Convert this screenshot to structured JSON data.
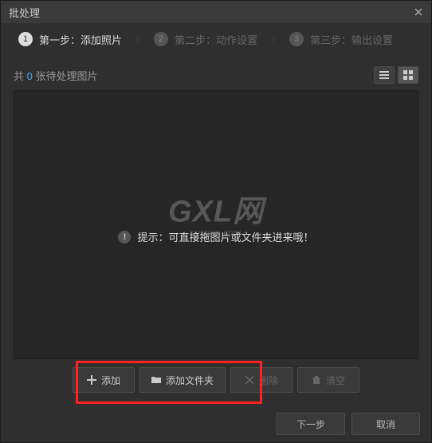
{
  "window": {
    "title": "批处理"
  },
  "steps": {
    "s1": {
      "num": "1",
      "label": "第一步：添加照片"
    },
    "s2": {
      "num": "2",
      "label": "第二步：动作设置"
    },
    "s3": {
      "num": "3",
      "label": "第三步：输出设置"
    }
  },
  "header": {
    "prefix": "共 ",
    "count": "0",
    "suffix": " 张待处理图片"
  },
  "hint": {
    "text": "提示：可直接拖图片或文件夹进来哦！"
  },
  "watermark": {
    "logo": "GXL网",
    "sub": "system.com"
  },
  "actions": {
    "add": "添加",
    "addFolder": "添加文件夹",
    "delete": "删除",
    "clear": "清空"
  },
  "footer": {
    "next": "下一步",
    "cancel": "取消"
  }
}
